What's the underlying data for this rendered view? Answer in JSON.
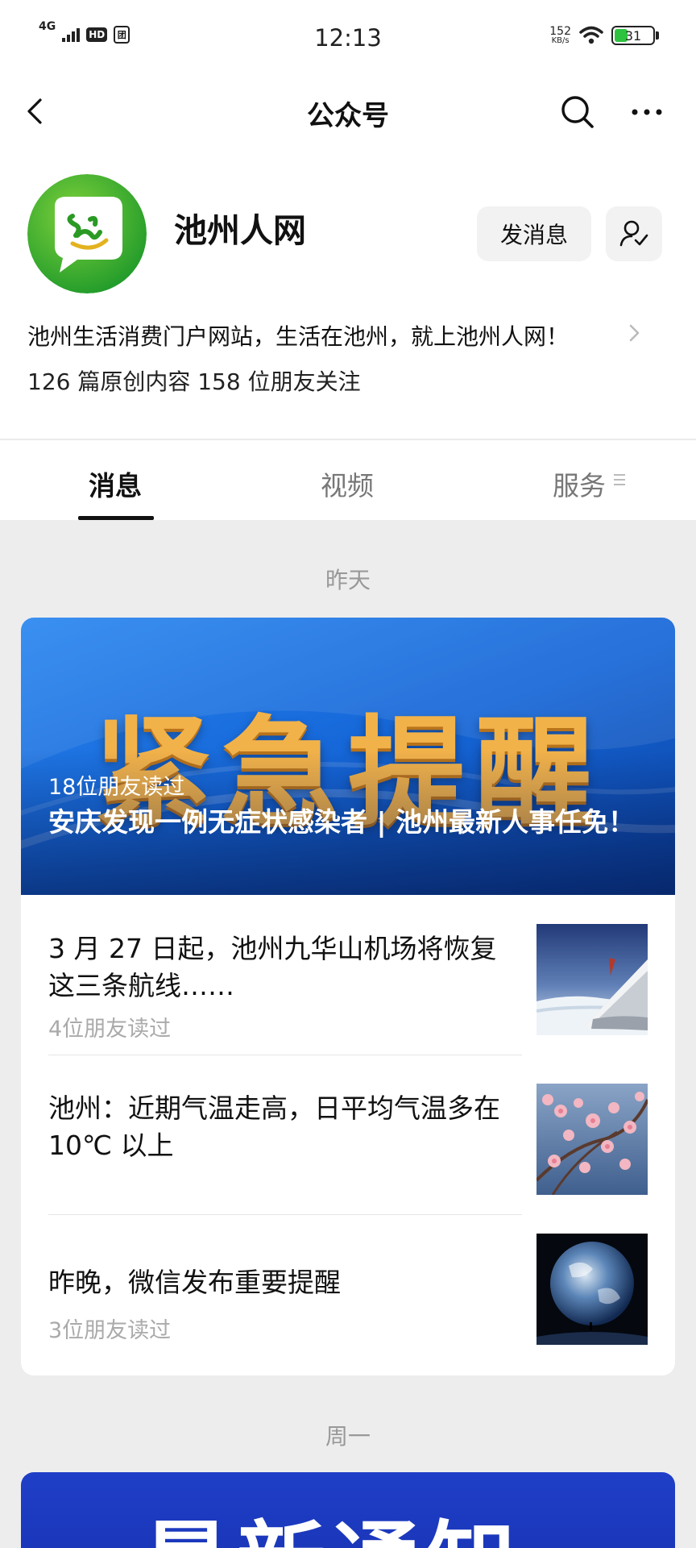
{
  "status_bar": {
    "network": "4G",
    "hd": "HD",
    "sim": "团",
    "time": "12:13",
    "speed_value": "152",
    "speed_unit": "KB/s",
    "battery": "31"
  },
  "nav": {
    "title": "公众号",
    "icons": [
      "back-arrow-icon",
      "search-icon",
      "more-icon"
    ]
  },
  "profile": {
    "name": "池州人网",
    "message_button": "发消息",
    "description": "池州生活消费门户网站，生活在池州，就上池州人网！",
    "stats": "126 篇原创内容  158 位朋友关注"
  },
  "tabs": [
    {
      "label": "消息",
      "active": true
    },
    {
      "label": "视频",
      "active": false
    },
    {
      "label": "服务",
      "active": false
    }
  ],
  "feed": {
    "date_1": "昨天",
    "date_2": "周一",
    "headline": {
      "cover_text": "紧急提醒",
      "reads": "18位朋友读过",
      "title": "安庆发现一例无症状感染者 | 池州最新人事任免！"
    },
    "articles": [
      {
        "title": "3 月 27 日起，池州九华山机场将恢复这三条航线……",
        "reads": "4位朋友读过",
        "thumb": "airplane-wing"
      },
      {
        "title": "池州：近期气温走高，日平均气温多在 10℃ 以上",
        "reads": "",
        "thumb": "plum-blossom"
      },
      {
        "title": "昨晚，微信发布重要提醒",
        "reads": "3位朋友读过",
        "thumb": "earth-from-space"
      }
    ],
    "next_cover_text": "最新通知"
  },
  "colors": {
    "accent_green": "#2ec33f",
    "cover_gold": "#f2b24a",
    "cover_blue": "#1566d8"
  }
}
